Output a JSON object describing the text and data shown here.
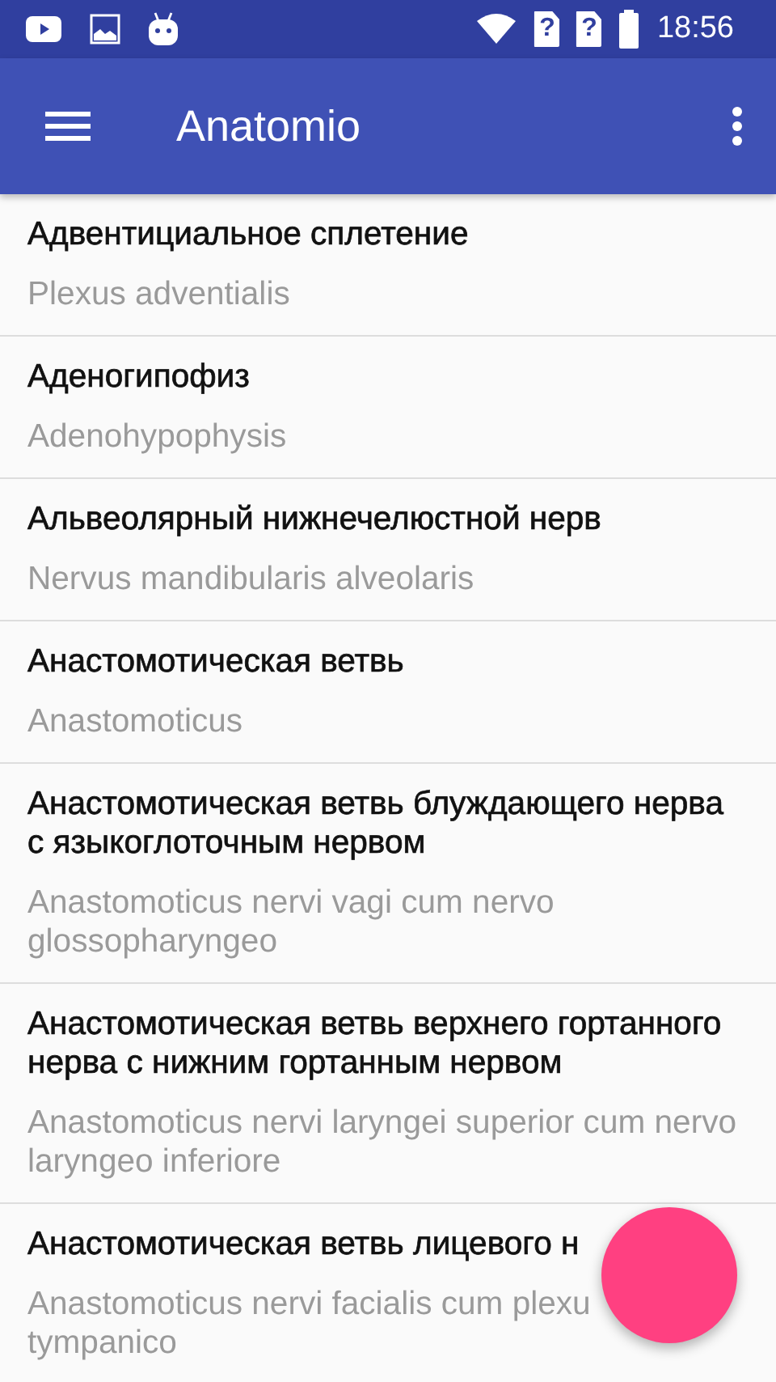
{
  "status_bar": {
    "time": "18:56",
    "sim_slots": [
      {
        "mark": "?"
      },
      {
        "mark": "?"
      }
    ]
  },
  "app_bar": {
    "title": "Anatomio"
  },
  "items": [
    {
      "title": [
        "Адвентициальное сплетение"
      ],
      "subtitle": [
        "Plexus adventialis"
      ]
    },
    {
      "title": [
        "Аденогипофиз"
      ],
      "subtitle": [
        "Adenohypophysis"
      ]
    },
    {
      "title": [
        "Альвеолярный нижнечелюстной нерв"
      ],
      "subtitle": [
        "Nervus mandibularis alveolaris"
      ]
    },
    {
      "title": [
        "Анастомотическая ветвь"
      ],
      "subtitle": [
        "Anastomoticus"
      ]
    },
    {
      "title": [
        "Анастомотическая ветвь блуждающего нерва",
        "с языкоглоточным нервом"
      ],
      "subtitle": [
        "Anastomoticus nervi vagi cum nervo",
        "glossopharyngeo"
      ]
    },
    {
      "title": [
        "Анастомотическая ветвь верхнего гортанного",
        "нерва с нижним гортанным нервом"
      ],
      "subtitle": [
        "Anastomoticus nervi laryngei superior cum nervo",
        "laryngeo inferiore"
      ]
    },
    {
      "title": [
        "Анастомотическая ветвь лицевого н"
      ],
      "subtitle": [
        "Anastomoticus nervi facialis cum plexu",
        "tympanico"
      ]
    }
  ],
  "fab": {
    "kind": "round"
  }
}
